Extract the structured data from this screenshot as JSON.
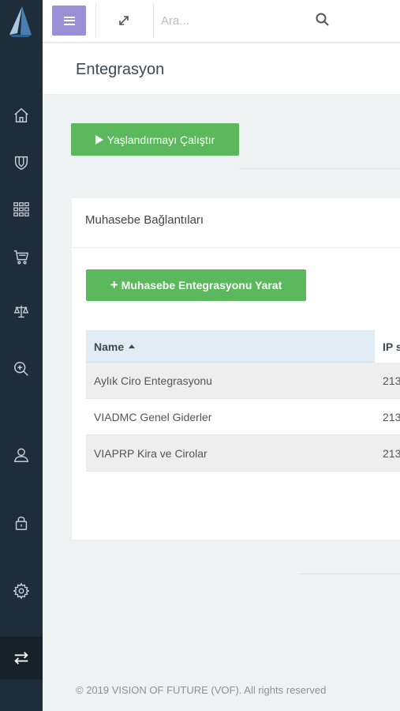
{
  "topbar": {
    "search_placeholder": "Ara..."
  },
  "page": {
    "title": "Entegrasyon"
  },
  "actions": {
    "run_aging_label": "Yaşlandırmayı Çalıştır"
  },
  "panel": {
    "title": "Muhasebe Bağlantıları",
    "create_label": "Muhasebe Entegrasyonu Yarat",
    "table": {
      "columns": [
        "Name",
        "IP s"
      ],
      "rows": [
        {
          "name": "Aylık Ciro Entegrasyonu",
          "ip": "213"
        },
        {
          "name": "VIADMC Genel Giderler",
          "ip": "213"
        },
        {
          "name": "VIAPRP Kira ve Cirolar",
          "ip": "213"
        }
      ]
    }
  },
  "footer": {
    "copyright": "© 2019 VISION OF FUTURE (VOF). All rights reserved"
  },
  "colors": {
    "sidebar": "#1f2d3a",
    "accent_purple": "#9b8fd6",
    "success_green": "#5cb85c",
    "table_header": "#e1edf4"
  },
  "icons": [
    "home-icon",
    "shield-icon",
    "grid-icon",
    "cart-icon",
    "scale-icon",
    "zoom-in-icon",
    "user-icon",
    "lock-icon",
    "gear-icon",
    "transfer-icon",
    "expand-icon",
    "search-icon",
    "menu-icon"
  ]
}
